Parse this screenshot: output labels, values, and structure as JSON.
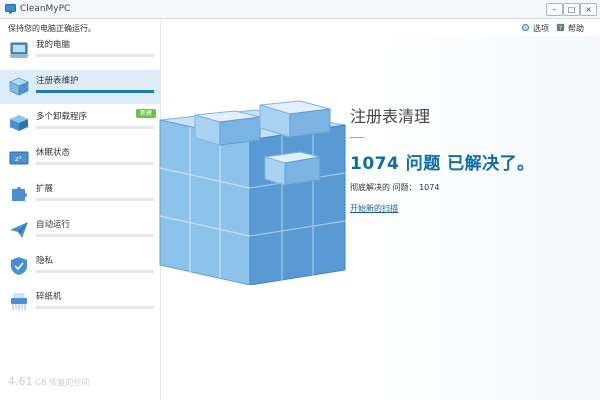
{
  "window": {
    "title": "CleanMyPC",
    "min_label": "–",
    "max_label": "□",
    "close_label": "×"
  },
  "sidebar": {
    "status_text": "保持您的电脑正确运行。",
    "items": [
      {
        "label": "我的电脑",
        "icon": "laptop-icon",
        "progress": 0
      },
      {
        "label": "注册表维护",
        "icon": "registry-cube-icon",
        "progress": 1.0,
        "active": true
      },
      {
        "label": "多个卸载程序",
        "icon": "uninstaller-box-icon",
        "progress": 0,
        "badge": "新建"
      },
      {
        "label": "休眠状态",
        "icon": "hibernation-icon",
        "progress": 0
      },
      {
        "label": "扩展",
        "icon": "puzzle-icon",
        "progress": 0
      },
      {
        "label": "自动运行",
        "icon": "paper-plane-icon",
        "progress": 0
      },
      {
        "label": "隐私",
        "icon": "shield-icon",
        "progress": 0
      },
      {
        "label": "碎纸机",
        "icon": "shredder-icon",
        "progress": 0
      }
    ],
    "footer": {
      "value": "4.61",
      "suffix": "GB 恢复的空间"
    }
  },
  "toolbar": {
    "options_label": "选项",
    "help_label": "帮助"
  },
  "main": {
    "title": "注册表清理",
    "headline": "1074 问题 已解决了。",
    "resolved_label": "彻底解决的 问题：",
    "resolved_count": "1074",
    "rescan_link": "开始新的扫描"
  },
  "colors": {
    "accent": "#1f78b4",
    "headline": "#0f6da6",
    "active_bg": "#dcedf9",
    "badge": "#6cc24a",
    "cube_top": "#b3d8f2",
    "cube_left": "#7fb9e6",
    "cube_right": "#4f93cf"
  }
}
